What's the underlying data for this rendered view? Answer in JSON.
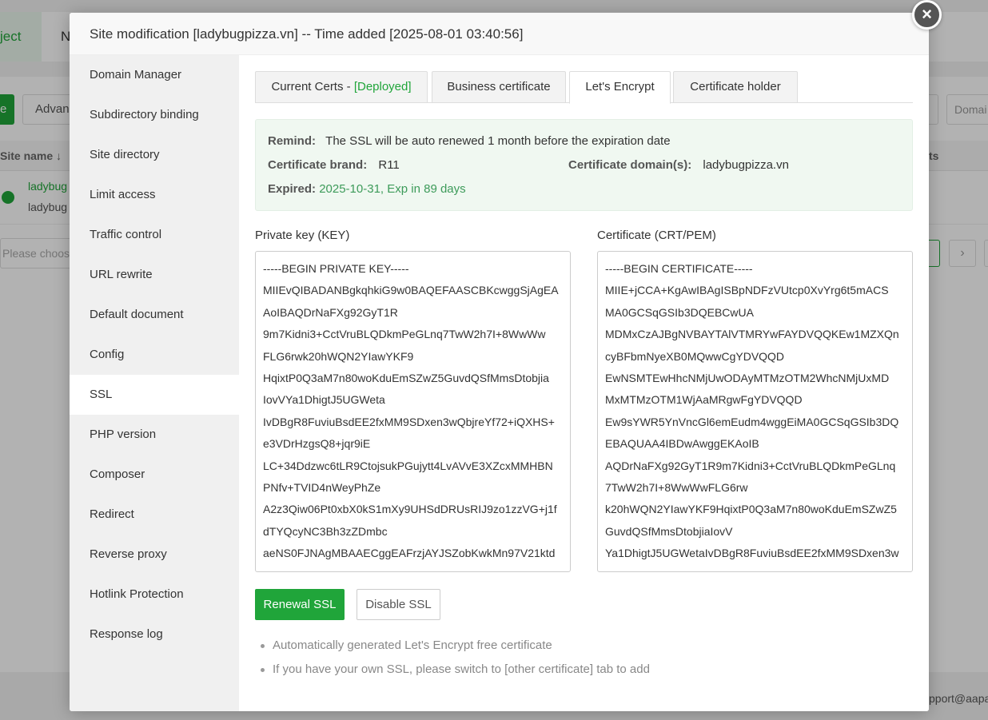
{
  "background": {
    "tab_active": "ject",
    "tab_second": "N",
    "green_button": "e",
    "advanced_button": "Advan",
    "table_header_left": "Site name",
    "table_header_right": "ts",
    "row_line1": "ladybug",
    "row_line2": "ladybug",
    "select_placeholder": "Please choos",
    "right_input_placeholder": "Domai",
    "pager_next": "›",
    "footer_text": "pport@aapa"
  },
  "modal": {
    "title": "Site modification [ladybugpizza.vn] -- Time added [2025-08-01 03:40:56]",
    "close": "×"
  },
  "sidebar": {
    "items": [
      {
        "label": "Domain Manager"
      },
      {
        "label": "Subdirectory binding"
      },
      {
        "label": "Site directory"
      },
      {
        "label": "Limit access"
      },
      {
        "label": "Traffic control"
      },
      {
        "label": "URL rewrite"
      },
      {
        "label": "Default document"
      },
      {
        "label": "Config"
      },
      {
        "label": "SSL"
      },
      {
        "label": "PHP version"
      },
      {
        "label": "Composer"
      },
      {
        "label": "Redirect"
      },
      {
        "label": "Reverse proxy"
      },
      {
        "label": "Hotlink Protection"
      },
      {
        "label": "Response log"
      }
    ],
    "active": "SSL"
  },
  "tabs": {
    "current_certs": "Current Certs - ",
    "current_certs_status": "[Deployed]",
    "business_certificate": "Business certificate",
    "lets_encrypt": "Let's Encrypt",
    "certificate_holder": "Certificate holder",
    "active": "Let's Encrypt"
  },
  "info": {
    "remind_label": "Remind:",
    "remind_text": "The SSL will be auto renewed 1 month before the expiration date",
    "brand_label": "Certificate brand:",
    "brand_value": "R11",
    "domain_label": "Certificate domain(s):",
    "domain_value": "ladybugpizza.vn",
    "expired_label": "Expired:",
    "expired_value": "2025-10-31, Exp in 89 days"
  },
  "private_key": {
    "label": "Private key (KEY)",
    "lines": [
      "-----BEGIN PRIVATE KEY-----",
      "MIIEvQIBADANBgkqhkiG9w0BAQEFAASCBKcwggSjAgEA",
      "AoIBAQDrNaFXg92GyT1R",
      "9m7Kidni3+CctVruBLQDkmPeGLnq7TwW2h7I+8WwWw",
      "FLG6rwk20hWQN2YIawYKF9",
      "HqixtP0Q3aM7n80woKduEmSZwZ5GuvdQSfMmsDtobjia",
      "IovVYa1DhigtJ5UGWeta",
      "IvDBgR8FuviuBsdEE2fxMM9SDxen3wQbjreYf72+iQXHS+",
      "e3VDrHzgsQ8+jqr9iE",
      "LC+34Ddzwc6tLR9CtojsukPGujytt4LvAVvE3XZcxMMHBN",
      "PNfv+TVID4nWeyPhZe",
      "A2z3Qiw06Pt0xbX0kS1mXy9UHSdDRUsRIJ9zo1zzVG+j1f",
      "dTYQcyNC3Bh3zZDmbc",
      "aeNS0FJNAgMBAAECggEAFrzjAYJSZobKwkMn97V21ktd"
    ]
  },
  "certificate": {
    "label": "Certificate (CRT/PEM)",
    "lines": [
      "-----BEGIN CERTIFICATE-----",
      "MIIE+jCCA+KgAwIBAgISBpNDFzVUtcp0XvYrg6t5mACS",
      "MA0GCSqGSIb3DQEBCwUA",
      "MDMxCzAJBgNVBAYTAlVTMRYwFAYDVQQKEw1MZXQn",
      "cyBFbmNyeXB0MQwwCgYDVQQD",
      "EwNSMTEwHhcNMjUwODAyMTMzOTM2WhcNMjUxMD",
      "MxMTMzOTM1WjAaMRgwFgYDVQQD",
      "Ew9sYWR5YnVncGl6emEudm4wggEiMA0GCSqGSIb3DQ",
      "EBAQUAA4IBDwAwggEKAoIB",
      "AQDrNaFXg92GyT1R9m7Kidni3+CctVruBLQDkmPeGLnq",
      "7TwW2h7I+8WwWwFLG6rw",
      "k20hWQN2YIawYKF9HqixtP0Q3aM7n80woKduEmSZwZ5",
      "GuvdQSfMmsDtobjiaIovV",
      "Ya1DhigtJ5UGWetaIvDBgR8FuviuBsdEE2fxMM9SDxen3w"
    ]
  },
  "actions": {
    "renew": "Renewal SSL",
    "disable": "Disable SSL"
  },
  "tips": [
    "Automatically generated Let's Encrypt free certificate",
    "If you have your own SSL, please switch to [other certificate] tab to add"
  ],
  "colors": {
    "accent": "#20a53a",
    "info_bg": "#f0f8f1",
    "expired_text": "#3d9b5a"
  }
}
